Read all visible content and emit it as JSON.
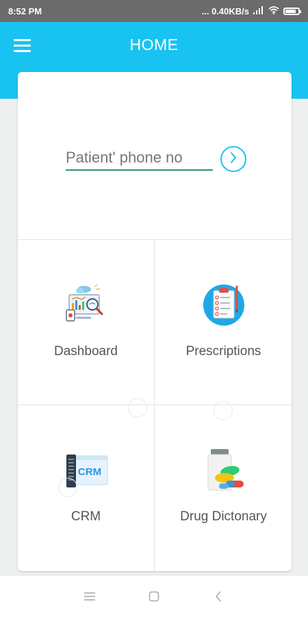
{
  "status_bar": {
    "time": "8:52 PM",
    "network_speed": "... 0.40KB/s",
    "battery_level": 0.85,
    "icons": [
      "signal-icon",
      "wifi-icon",
      "battery-icon"
    ]
  },
  "app_bar": {
    "title": "HOME",
    "menu_icon": "hamburger-menu-icon"
  },
  "search": {
    "placeholder": "Patient' phone no",
    "value": "",
    "submit_icon": "chevron-right-icon"
  },
  "tiles": [
    {
      "label": "Dashboard",
      "icon": "dashboard-analytics-icon"
    },
    {
      "label": "Prescriptions",
      "icon": "clipboard-checklist-icon"
    },
    {
      "label": "CRM",
      "icon": "crm-icon",
      "icon_text": "CRM"
    },
    {
      "label": "Drug Dictonary",
      "icon": "pills-bottle-icon"
    }
  ],
  "colors": {
    "primary": "#18c3f2",
    "input_underline": "#2f8f7f",
    "status_bar": "#6b6b6b",
    "background": "#eef0f0"
  },
  "nav_bar": {
    "buttons": [
      "recent-apps-icon",
      "home-icon",
      "back-icon"
    ]
  }
}
